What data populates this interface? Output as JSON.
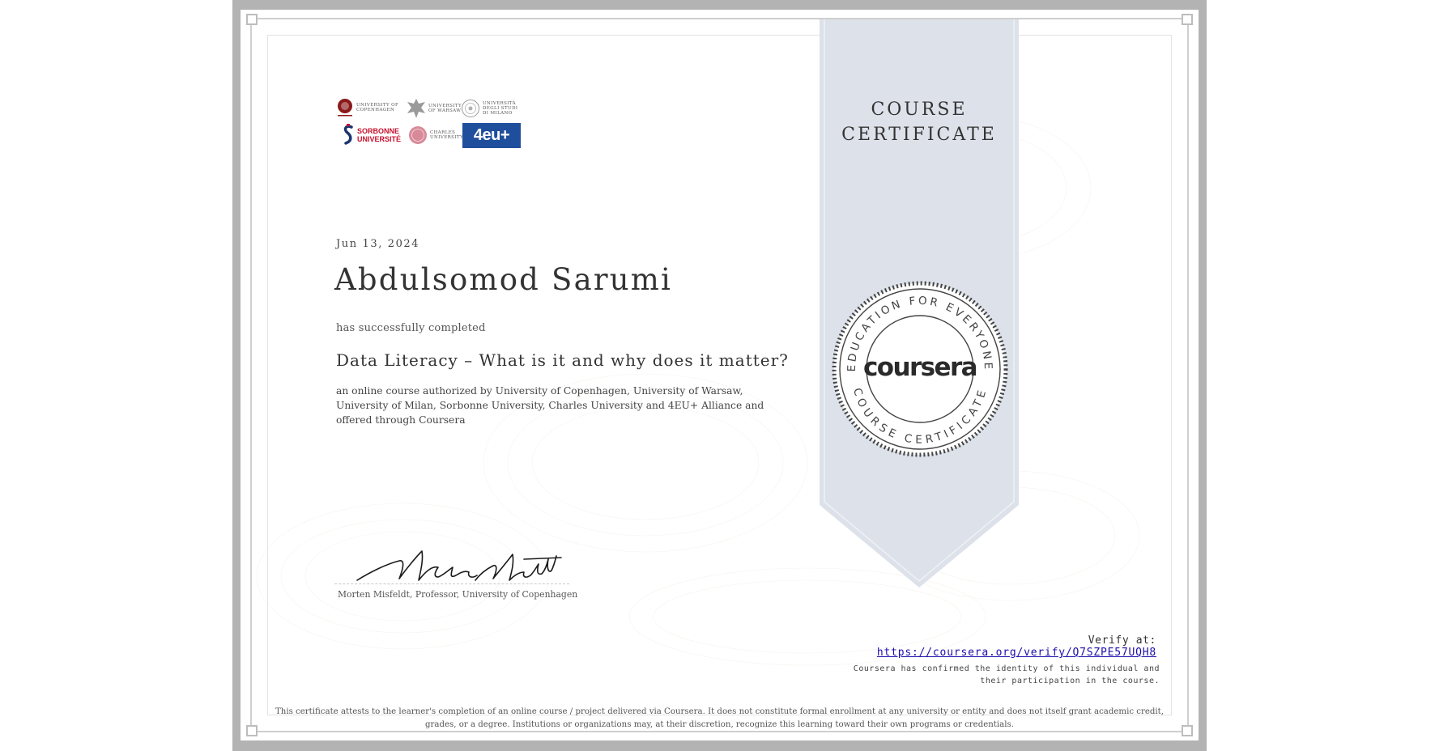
{
  "logos": {
    "copenhagen": [
      "University of",
      "Copenhagen"
    ],
    "warsaw": [
      "University",
      "of Warsaw"
    ],
    "milan": [
      "Università",
      "degli studi",
      "di Milano"
    ],
    "sorbonne": [
      "SORBONNE",
      "UNIVERSITÉ"
    ],
    "charles": [
      "Charles",
      "University"
    ],
    "fourEu": "4eu+"
  },
  "certificate": {
    "date": "Jun 13, 2024",
    "recipient": "Abdulsomod Sarumi",
    "completed_text": "has successfully completed",
    "course_title": "Data Literacy – What is it and why does it matter?",
    "course_description": "an online course authorized by University of Copenhagen, University of Warsaw, University of Milan, Sorbonne University, Charles University and 4EU+ Alliance and offered through Coursera",
    "signer": "Morten Misfeldt, Professor, University of Copenhagen"
  },
  "ribbon": {
    "title_line1": "COURSE",
    "title_line2": "CERTIFICATE",
    "seal_top_text": "EDUCATION FOR EVERYONE",
    "seal_bottom_text": "COURSE CERTIFICATE",
    "seal_word": "coursera"
  },
  "verification": {
    "label": "Verify at:",
    "url": "https://coursera.org/verify/Q7SZPE57UQH8",
    "note": "Coursera has confirmed the identity of this individual and their participation in the course."
  },
  "disclaimer": "This certificate attests to the learner's completion of an online course / project delivered via Coursera. It does not constitute formal enrollment at any university or entity and does not itself grant academic credit, grades, or a degree. Institutions or organizations may, at their discretion, recognize this learning toward their own programs or credentials.",
  "colors": {
    "ribbon": "#dde2ea",
    "link": "#1a0dab",
    "frame_outer": "#b3b3b3"
  }
}
